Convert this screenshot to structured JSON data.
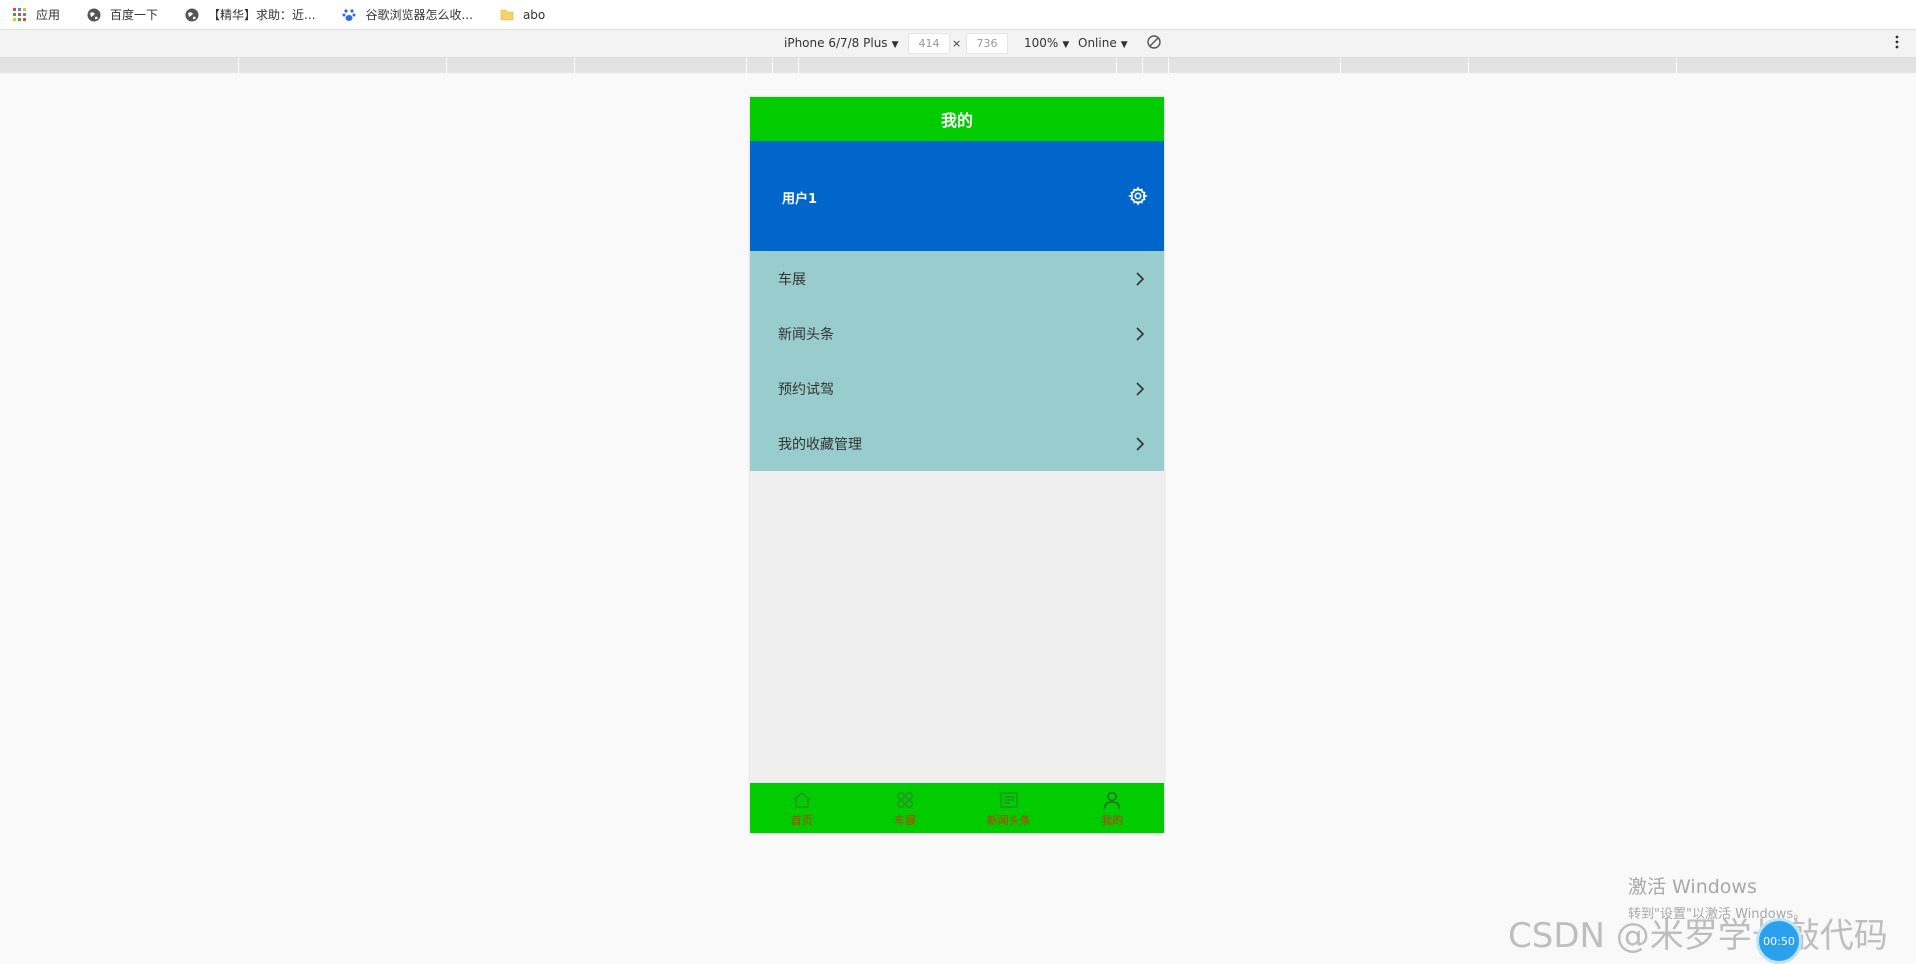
{
  "bookmarks": [
    {
      "label": "应用",
      "icon": "apps-grid-icon"
    },
    {
      "label": "百度一下",
      "icon": "globe-icon"
    },
    {
      "label": "【精华】求助：近...",
      "icon": "globe-icon"
    },
    {
      "label": "谷歌浏览器怎么收...",
      "icon": "baidu-paw-icon"
    },
    {
      "label": "abo",
      "icon": "folder-icon"
    }
  ],
  "devtools": {
    "device": "iPhone 6/7/8 Plus",
    "width": "414",
    "times": "×",
    "height": "736",
    "zoom": "100%",
    "network": "Online"
  },
  "app": {
    "title": "我的",
    "user_name": "用户1",
    "menu": [
      {
        "label": "车展"
      },
      {
        "label": "新闻头条"
      },
      {
        "label": "预约试驾"
      },
      {
        "label": "我的收藏管理"
      }
    ],
    "tabs": [
      {
        "label": "首页",
        "icon": "home-icon"
      },
      {
        "label": "车展",
        "icon": "grid-clover-icon"
      },
      {
        "label": "新闻头条",
        "icon": "news-icon"
      },
      {
        "label": "我的",
        "icon": "user-icon"
      }
    ]
  },
  "overlays": {
    "activate_title": "激活 Windows",
    "activate_sub": "转到\"设置\"以激活 Windows。",
    "watermark": "CSDN @米罗学长敲代码",
    "timer": "00:50"
  },
  "colors": {
    "header_green": "#00cc00",
    "user_blue": "#0066cc",
    "menu_teal": "#99cccc",
    "tab_label": "#cc3300"
  }
}
